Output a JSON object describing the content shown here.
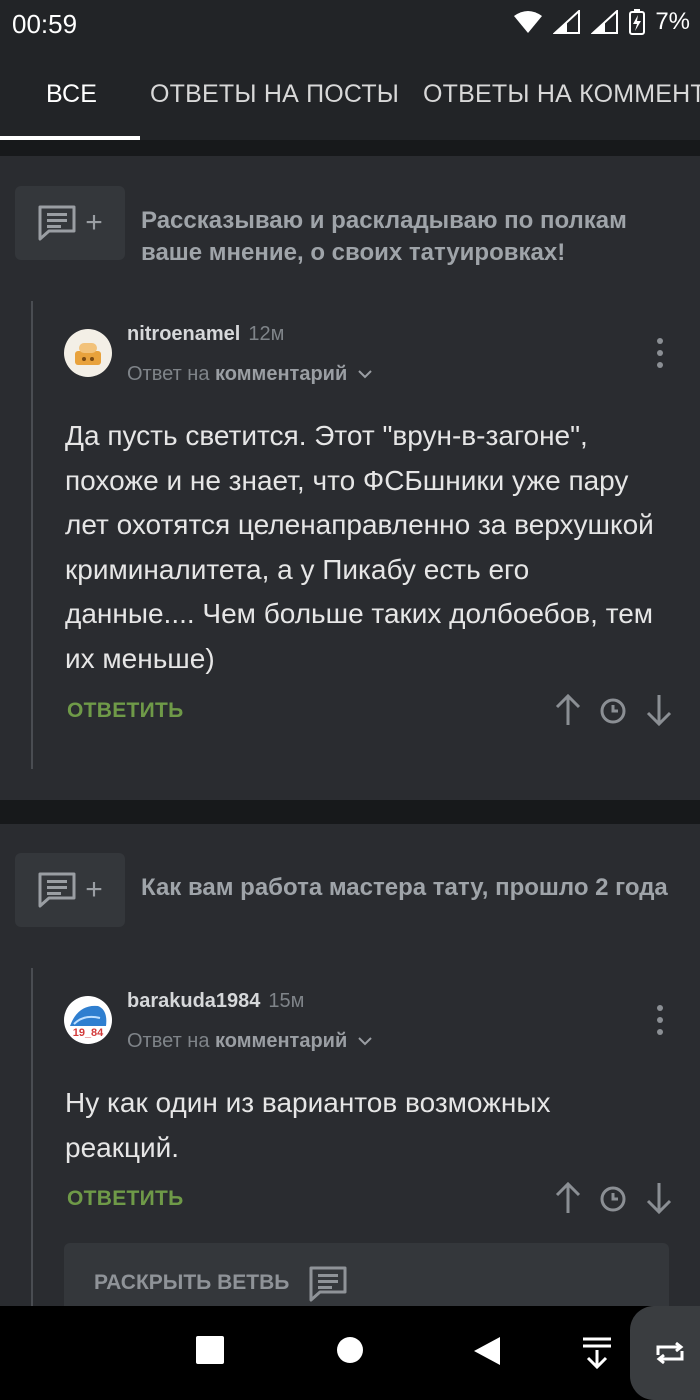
{
  "status": {
    "time": "00:59",
    "battery": "7%"
  },
  "tabs": [
    {
      "label": "ВСЕ"
    },
    {
      "label": "ОТВЕТЫ НА ПОСТЫ"
    },
    {
      "label": "ОТВЕТЫ НА КОММЕНТАРИИ"
    }
  ],
  "threads": [
    {
      "post_title": "Рассказываю и раскладываю по полкам ваше мнение, о своих татуировках!",
      "comment": {
        "user": "nitroenamel",
        "time": "12м",
        "reply_prefix": "Ответ на",
        "reply_target": "комментарий",
        "text": "Да пусть светится. Этот \"врун-в-загоне\", похоже и не знает, что ФСБшники уже пару лет охотятся целенаправленно за верхушкой криминалитета, а у Пикабу есть его данные.... Чем больше таких долбоебов, тем их меньше)",
        "reply_label": "ОТВЕТИТЬ"
      }
    },
    {
      "post_title": "Как вам работа мастера тату, прошло 2 года",
      "comment": {
        "user": "barakuda1984",
        "time": "15м",
        "reply_prefix": "Ответ на",
        "reply_target": "комментарий",
        "text": "Ну как один из вариантов возможных реакций.",
        "reply_label": "ОТВЕТИТЬ",
        "expand_label": "РАСКРЫТЬ ВЕТВЬ"
      }
    }
  ],
  "avatar_text": "19_84",
  "colors": {
    "accent_green": "#6f9a48",
    "background": "#222427",
    "card": "#2a2c30"
  }
}
